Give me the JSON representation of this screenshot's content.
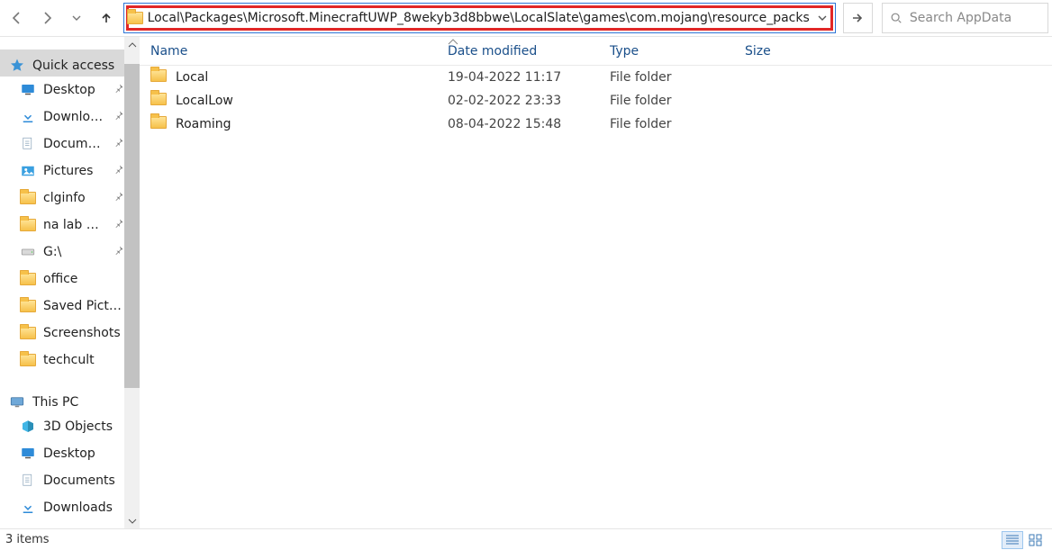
{
  "address_path": "Local\\Packages\\Microsoft.MinecraftUWP_8wekyb3d8bbwe\\LocalSlate\\games\\com.mojang\\resource_packs",
  "search_placeholder": "Search AppData",
  "nav": {
    "quick_access": "Quick access",
    "items_pinned": [
      {
        "label": "Desktop",
        "icon": "desktop"
      },
      {
        "label": "Downloads",
        "icon": "downloads"
      },
      {
        "label": "Documents",
        "icon": "documents"
      },
      {
        "label": "Pictures",
        "icon": "pictures"
      },
      {
        "label": "clginfo",
        "icon": "folder"
      },
      {
        "label": "na lab exp",
        "icon": "folder"
      },
      {
        "label": "G:\\",
        "icon": "drive"
      }
    ],
    "items_recent": [
      {
        "label": "office",
        "icon": "folder"
      },
      {
        "label": "Saved Pictures",
        "icon": "folder"
      },
      {
        "label": "Screenshots",
        "icon": "folder"
      },
      {
        "label": "techcult",
        "icon": "folder"
      }
    ],
    "this_pc": "This PC",
    "pc_items": [
      {
        "label": "3D Objects",
        "icon": "objects3d"
      },
      {
        "label": "Desktop",
        "icon": "desktop"
      },
      {
        "label": "Documents",
        "icon": "documents"
      },
      {
        "label": "Downloads",
        "icon": "downloads"
      }
    ]
  },
  "columns": {
    "name": "Name",
    "date": "Date modified",
    "type": "Type",
    "size": "Size"
  },
  "rows": [
    {
      "name": "Local",
      "date": "19-04-2022 11:17",
      "type": "File folder"
    },
    {
      "name": "LocalLow",
      "date": "02-02-2022 23:33",
      "type": "File folder"
    },
    {
      "name": "Roaming",
      "date": "08-04-2022 15:48",
      "type": "File folder"
    }
  ],
  "status_text": "3 items"
}
